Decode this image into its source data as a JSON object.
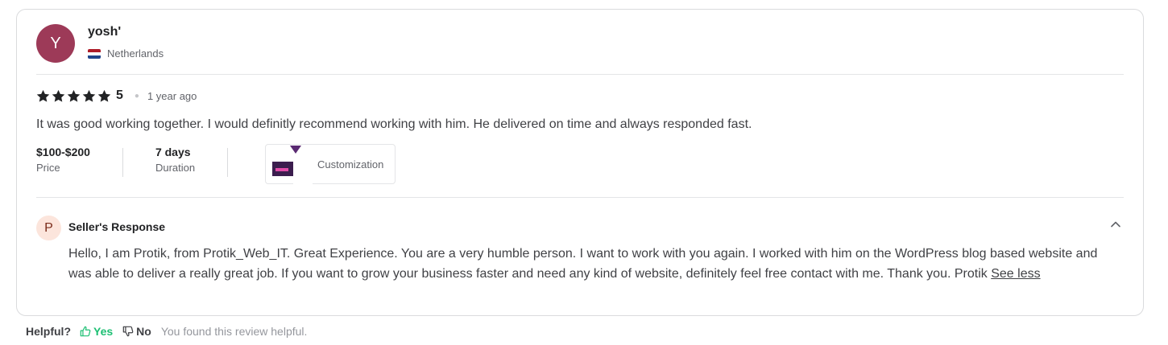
{
  "reviewer": {
    "initial": "Y",
    "name": "yosh'",
    "country": "Netherlands",
    "flag_icon": "netherlands-flag-icon",
    "avatar_color": "#9d3a58"
  },
  "review": {
    "stars": 5,
    "rating": "5",
    "time_ago": "1 year ago",
    "text": "It was good working together. I would definitly recommend working with him. He delivered on time and always responded fast."
  },
  "meta": {
    "price_value": "$100-$200",
    "price_label": "Price",
    "duration_value": "7 days",
    "duration_label": "Duration",
    "gig_label": "Customization"
  },
  "seller_response": {
    "initial": "P",
    "title": "Seller's Response",
    "text": "Hello, I am Protik, from Protik_Web_IT. Great Experience. You are a very humble person. I want to work with you again. I worked with him on the WordPress blog based website and was able to deliver a really great job. If you want to grow your business faster and need any kind of website, definitely feel free contact with me. Thank you. Protik",
    "see_less": "See less"
  },
  "helpful": {
    "label": "Helpful?",
    "yes": "Yes",
    "no": "No",
    "message": "You found this review helpful.",
    "yes_color": "#1dbf73"
  }
}
